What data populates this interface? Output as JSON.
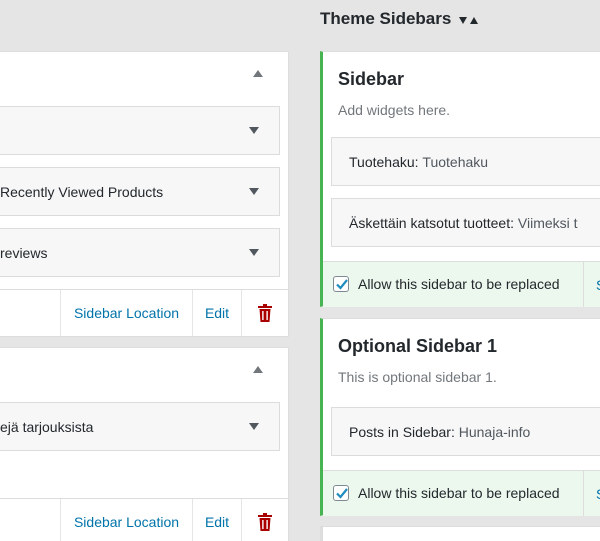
{
  "left": {
    "panels": [
      {
        "widgets": [
          {
            "label": ""
          },
          {
            "label": "Recently Viewed Products"
          },
          {
            "label": "reviews"
          }
        ],
        "footer": {
          "location_label": "Sidebar Location",
          "edit_label": "Edit"
        }
      },
      {
        "widgets": [
          {
            "label": "ejä tarjouksista"
          }
        ],
        "footer": {
          "location_label": "Sidebar Location",
          "edit_label": "Edit"
        }
      }
    ]
  },
  "right": {
    "section_title": "Theme Sidebars",
    "sidebars": [
      {
        "title": "Sidebar",
        "description": "Add widgets here.",
        "widgets": [
          {
            "title": "Tuotehaku:",
            "instance": "Tuotehaku"
          },
          {
            "title": "Äskettäin katsotut tuotteet:",
            "instance": "Viimeksi t"
          }
        ],
        "replace_label": "Allow this sidebar to be replaced",
        "replace_checked": true,
        "side_link": "S"
      },
      {
        "title": "Optional Sidebar 1",
        "description": "This is optional sidebar 1.",
        "widgets": [
          {
            "title": "Posts in Sidebar:",
            "instance": "Hunaja-info"
          }
        ],
        "replace_label": "Allow this sidebar to be replaced",
        "replace_checked": true,
        "side_link": "S"
      }
    ]
  },
  "colors": {
    "accent_green": "#46b450",
    "link_blue": "#0073aa",
    "trash_red": "#a00",
    "replace_bg": "#ecf7ed"
  },
  "icons": {
    "collapse": "caret-up-icon",
    "expand": "caret-down-icon",
    "delete": "trash-icon",
    "sort": "sort-icon",
    "checkbox": "checkmark-icon"
  }
}
